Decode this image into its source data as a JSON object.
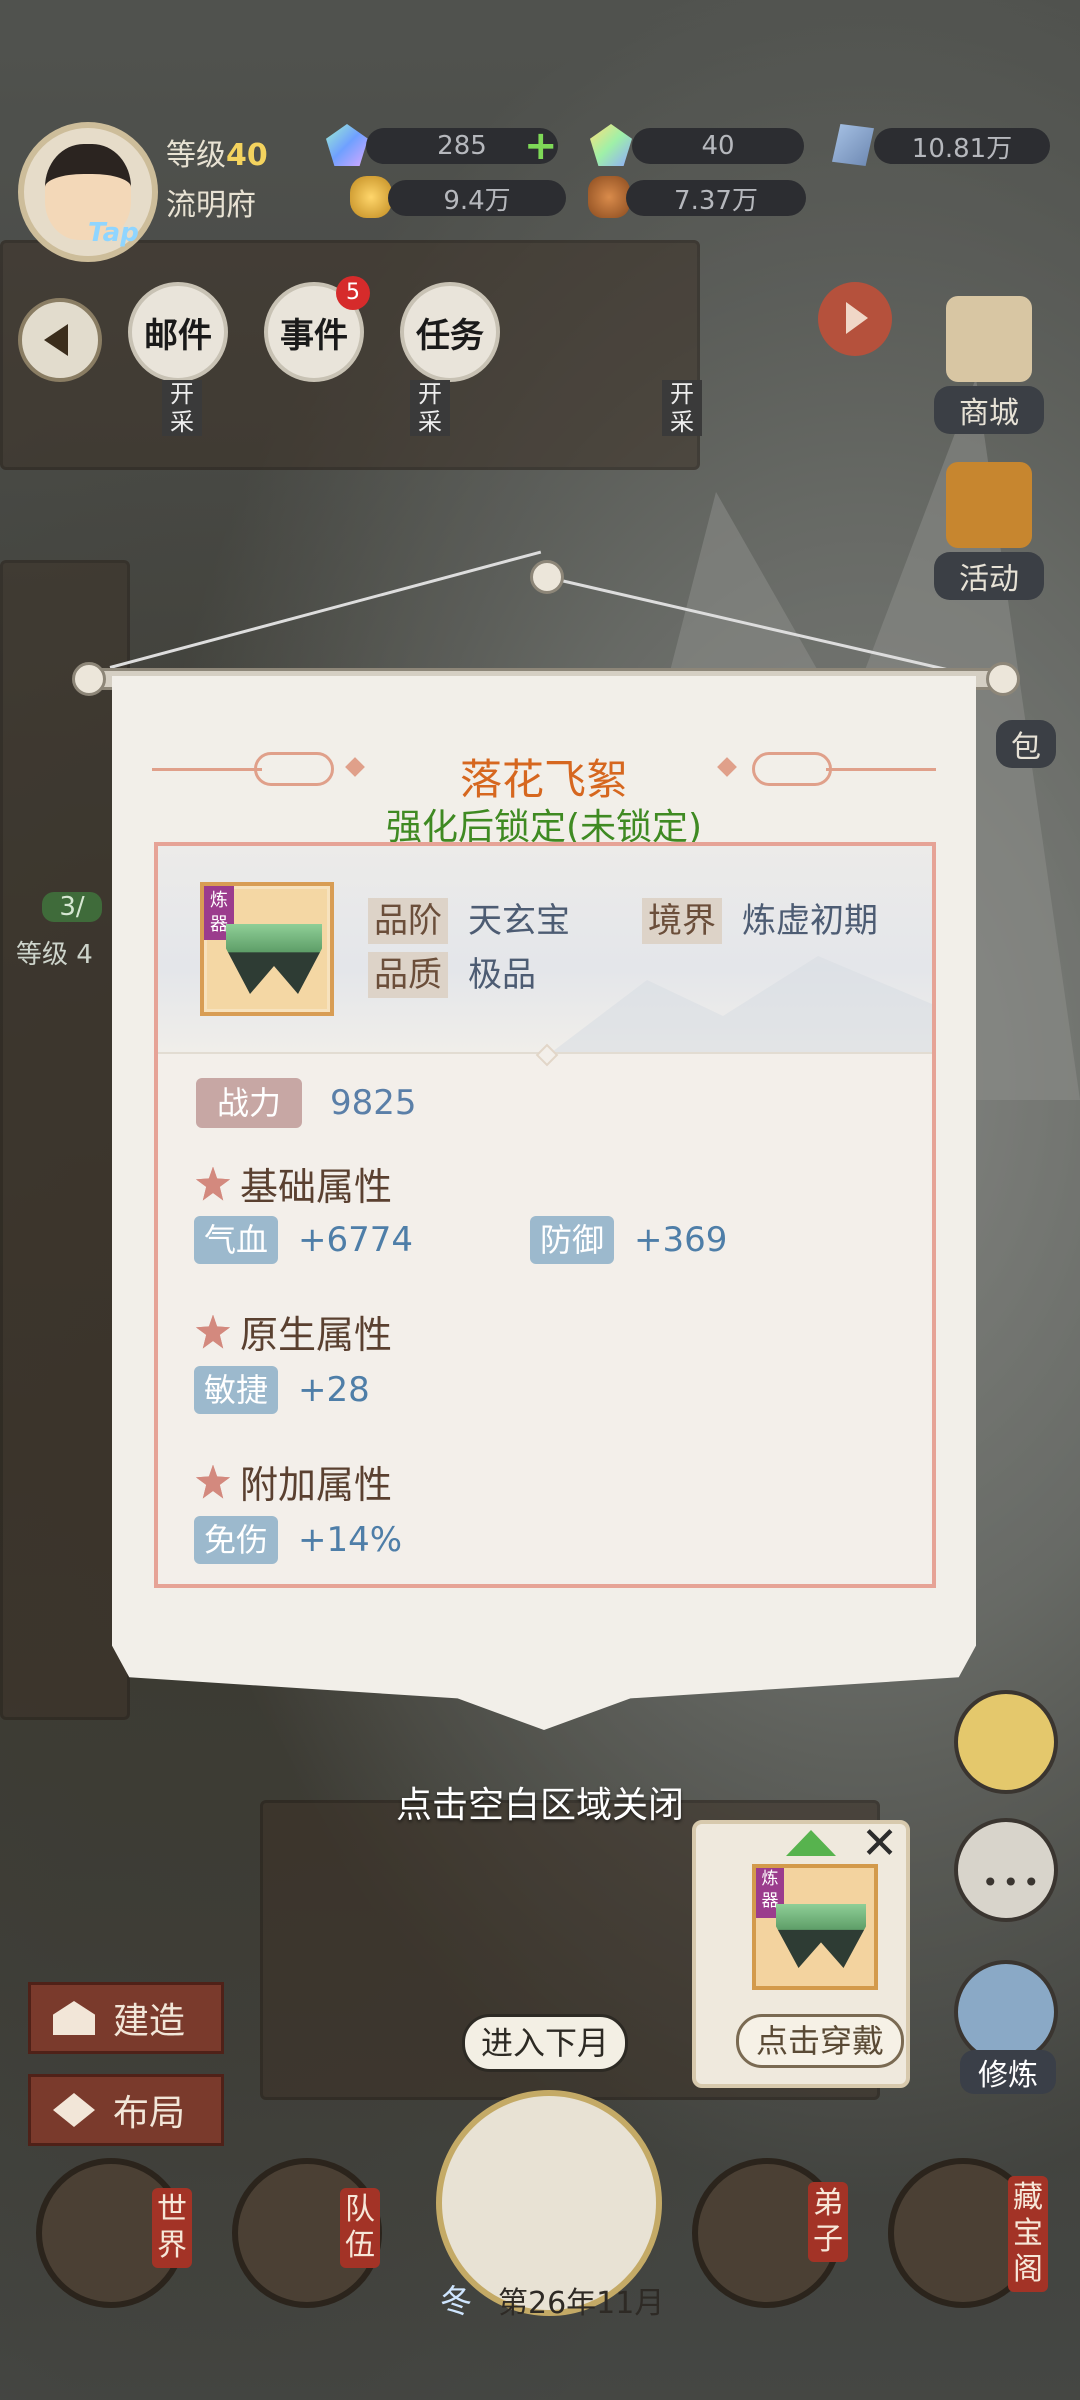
{
  "hud": {
    "level_label": "等级",
    "level_value": "40",
    "house_name": "流明府",
    "tap_label": "Tap",
    "resources": [
      {
        "icon": "spirit-gem-icon",
        "value": "285"
      },
      {
        "icon": "rainbow-gem-icon",
        "value": "40"
      },
      {
        "icon": "blue-crystal-icon",
        "value": "10.81万"
      },
      {
        "icon": "gold-ingot-icon",
        "value": "9.4万"
      },
      {
        "icon": "wood-icon",
        "value": "7.37万"
      }
    ]
  },
  "nav": {
    "tiles": [
      "邮件",
      "事件",
      "任务"
    ],
    "event_badge": "5",
    "mining_labels": [
      "开采",
      "开采",
      "开采"
    ],
    "side": [
      "商城",
      "活动",
      "包"
    ]
  },
  "left_panel": {
    "progress": "3/",
    "level": "等级 4"
  },
  "modal": {
    "item_name": "落花飞絮",
    "lock_state": "强化后锁定(未锁定)",
    "thumb_tag": "炼器",
    "grade_label": "品阶",
    "grade_value": "天玄宝",
    "realm_label": "境界",
    "realm_value": "炼虚初期",
    "quality_label": "品质",
    "quality_value": "极品",
    "power_label": "战力",
    "power_value": "9825",
    "sections": [
      {
        "title": "基础属性",
        "attrs": [
          {
            "name": "气血",
            "value": "+6774"
          },
          {
            "name": "防御",
            "value": "+369"
          }
        ]
      },
      {
        "title": "原生属性",
        "attrs": [
          {
            "name": "敏捷",
            "value": "+28"
          }
        ]
      },
      {
        "title": "附加属性",
        "attrs": [
          {
            "name": "免伤",
            "value": "+14%"
          }
        ]
      }
    ]
  },
  "close_hint": "点击空白区域关闭",
  "bottom": {
    "build_label": "建造",
    "layout_label": "布局",
    "next_month": "进入下月",
    "season": "冬",
    "date": "第26年11月",
    "tabs": [
      "世界",
      "队伍",
      "弟子",
      "藏宝阁"
    ],
    "cultivate_label": "修炼",
    "equip_tag": "炼器",
    "equip_button": "点击穿戴"
  },
  "colors": {
    "accent_orange": "#d6671f",
    "lock_green": "#3f8a22",
    "attr_chip": "#9cb9cd",
    "power_chip": "#c7a7a4"
  }
}
